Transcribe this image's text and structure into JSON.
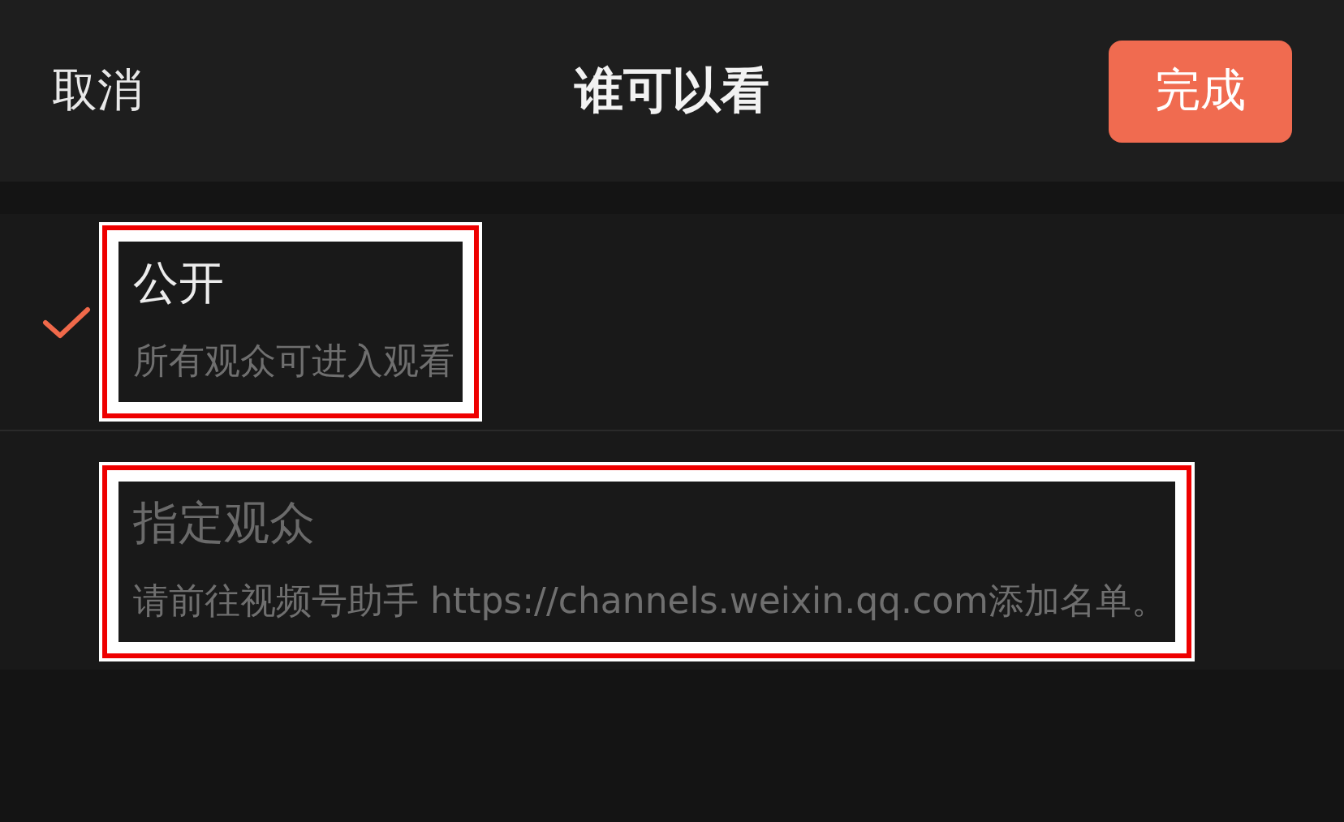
{
  "header": {
    "cancel": "取消",
    "title": "谁可以看",
    "done": "完成"
  },
  "options": [
    {
      "title": "公开",
      "description": "所有观众可进入观看",
      "selected": true,
      "disabled": false,
      "highlighted": true
    },
    {
      "title": "指定观众",
      "description": "请前往视频号助手 https://channels.weixin.qq.com添加名单。",
      "selected": false,
      "disabled": true,
      "highlighted": true
    }
  ]
}
